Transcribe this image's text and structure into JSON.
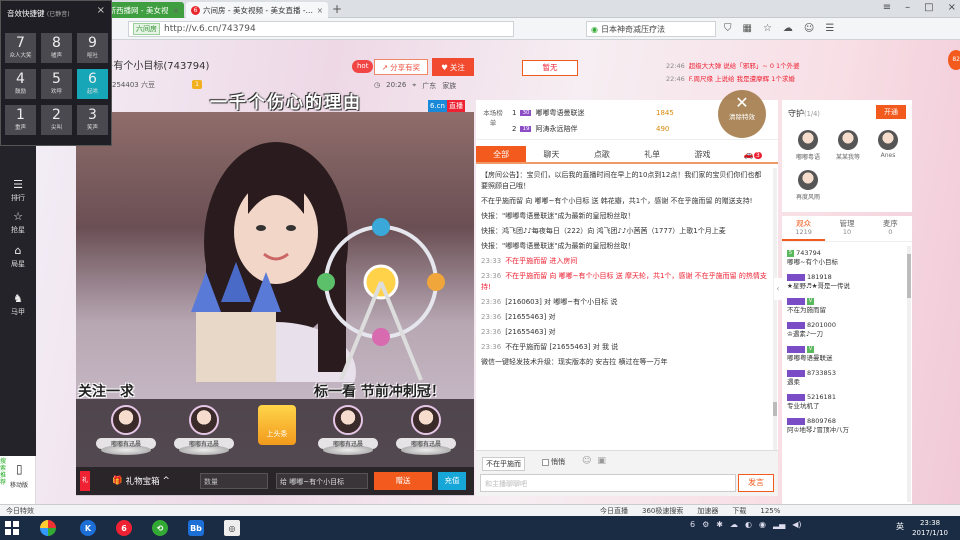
{
  "browser": {
    "tabs": [
      {
        "label": "古斯西播网 - 美女视"
      },
      {
        "label": "六间房 - 美女视频 - 美女直播 - 视"
      }
    ],
    "url_site": "六间房",
    "url": "http://v.6.cn/743794",
    "search_text": "日本神奇减压疗法"
  },
  "voice_panel": {
    "title": "音效快捷键",
    "subtitle": "(已静音)",
    "keys": [
      {
        "num": "7",
        "label": "众人大笑"
      },
      {
        "num": "8",
        "label": "嘘声"
      },
      {
        "num": "9",
        "label": "呕吐"
      },
      {
        "num": "4",
        "label": "鼓励"
      },
      {
        "num": "5",
        "label": "欢呼"
      },
      {
        "num": "6",
        "label": "起哄"
      },
      {
        "num": "1",
        "label": "重声"
      },
      {
        "num": "2",
        "label": "尖叫"
      },
      {
        "num": "3",
        "label": "笑声"
      }
    ]
  },
  "sidebar": {
    "items": [
      {
        "label": "排行",
        "icon": "rank-icon"
      },
      {
        "label": "抢星",
        "icon": "star-icon"
      },
      {
        "label": "局星",
        "icon": "house-icon"
      },
      {
        "label": "马甲",
        "icon": "shirt-icon"
      }
    ],
    "bottom_label": "移动版",
    "side_vertical": "搜索推荐"
  },
  "room": {
    "streamer": "嘟嘟~有个小目标(743794)",
    "fans": "254403 六豆",
    "fan_level": "1",
    "hot": "hot",
    "share": "分享有奖",
    "follow": "关注",
    "time": "20:26",
    "region": "广东",
    "home": "家族",
    "caption": "一千个伤心的理由",
    "ticker_left": "关注一求",
    "ticker_right": "标一看 节前冲刺冠！",
    "brand": "6.cn",
    "brand_tag": "直播",
    "notice_badge": "暂无"
  },
  "video_strip": {
    "avatars": [
      {
        "name": "嘟嘟有迅晨"
      },
      {
        "name": "嘟嘟有迅晨"
      },
      {
        "name": "嘟嘟有迅晨"
      },
      {
        "name": "嘟嘟有迅晨"
      }
    ],
    "top_tag": "上头条"
  },
  "gift_bar": {
    "red": "礼",
    "box": "礼物宝箱",
    "qty_placeholder": "数量",
    "target_prefix": "给",
    "target": "嘟嘟~有个小目标",
    "send": "赠送",
    "recharge": "充值"
  },
  "rank": {
    "label": "本场榜单",
    "rows": [
      {
        "no": "1",
        "level": "30",
        "name": "嘟嘟粤语曼联迷",
        "points": "1845"
      },
      {
        "no": "2",
        "level": "19",
        "name": "阿涛永远陪伴",
        "points": "490"
      }
    ]
  },
  "chat": {
    "tabs": [
      "全部",
      "聊天",
      "点歌",
      "礼单",
      "游戏",
      ""
    ],
    "tab_badge": "3",
    "messages": [
      {
        "t": "",
        "txt": "【房间公告】：宝贝们，以后我的直播时间在早上的10点到12点！我们家的宝贝们你们也都要照顾自己哦！"
      },
      {
        "t": "",
        "txt": "不在乎施而留 向 嘟嘟~有个小目标 送 韩花瓣，共1个，感谢 不在乎施而留 的赠送支持!"
      },
      {
        "t": "",
        "txt": "快报：\"嘟嘟粤语曼联迷\"成为最新的皇冠粉丝取！"
      },
      {
        "t": "",
        "txt": "快报：鸿飞团♪♪每夜每日（222）向 鸿飞团♪♪小茜茜（1777）上歌1个月上麦"
      },
      {
        "t": "",
        "txt": "快报：\"嘟嘟粤语曼联迷\"成为最新的皇冠粉丝取！"
      },
      {
        "t": "23:33",
        "txt": "不在乎施而留 进入房间"
      },
      {
        "t": "23:36",
        "txt": "不在乎施而留 向 嘟嘟~有个小目标 送 摩天轮，共1个，感谢 不在乎施而留 的热情支持!"
      },
      {
        "t": "23:36",
        "txt": "[2160603] 对 嘟嘟~有个小目标 说"
      },
      {
        "t": "23:36",
        "txt": "[21655463] 对"
      },
      {
        "t": "23:36",
        "txt": "[21655463] 对"
      },
      {
        "t": "23:36",
        "txt": "不在乎施而留 [21655463] 对 我 说"
      },
      {
        "t": "",
        "txt": "微信一键轻发技术升级：现实版本的 安吉拉 横过在等一万年"
      }
    ],
    "to": "不在乎施而",
    "private": "悄悄",
    "input_placeholder": "和主播聊聊吧",
    "send": "发言"
  },
  "clear_fx": {
    "icon": "✕",
    "label": "清除特效"
  },
  "broadcast": [
    {
      "t": "22:46",
      "txt": "超级大大弹 说给「邪邪」~ 0 1个外婆"
    },
    {
      "t": "22:46",
      "txt": "F.周尺缘 上说给 我是遭摩辉 1个求婚"
    }
  ],
  "guard": {
    "title": "守护",
    "count": "(1/4)",
    "open": "开通",
    "members": [
      {
        "name": "嘟嘟粤语"
      },
      {
        "name": "某某我等"
      },
      {
        "name": "Anes"
      },
      {
        "name": "再度风雨"
      }
    ]
  },
  "audience": {
    "tabs": [
      {
        "label": "观众",
        "count": "1219"
      },
      {
        "label": "管理",
        "count": "10"
      },
      {
        "label": "麦序",
        "count": "0"
      }
    ],
    "rows": [
      {
        "a": "743794",
        "b": "嘟嘟~有个小目标"
      },
      {
        "a": "181918",
        "b": "★星野♬★哥是一传说"
      },
      {
        "a": "",
        "b": "不在为施而留"
      },
      {
        "a": "8201000",
        "b": "♔遇素♪一刀"
      },
      {
        "a": "",
        "b": "嘟嘟粤语曼联迷"
      },
      {
        "a": "8733853",
        "b": "遇柔"
      },
      {
        "a": "5216181",
        "b": "专业坑机了"
      },
      {
        "a": "8809768",
        "b": "阿♔地琴♪冒顶冲八万"
      }
    ]
  },
  "statusbar": {
    "left": "今日特效",
    "items": [
      "今日直播",
      "360极速搜索",
      "加速器",
      "下载",
      "125%"
    ]
  },
  "taskbar": {
    "time": "23:38",
    "date": "2017/1/10",
    "ime": "英"
  }
}
